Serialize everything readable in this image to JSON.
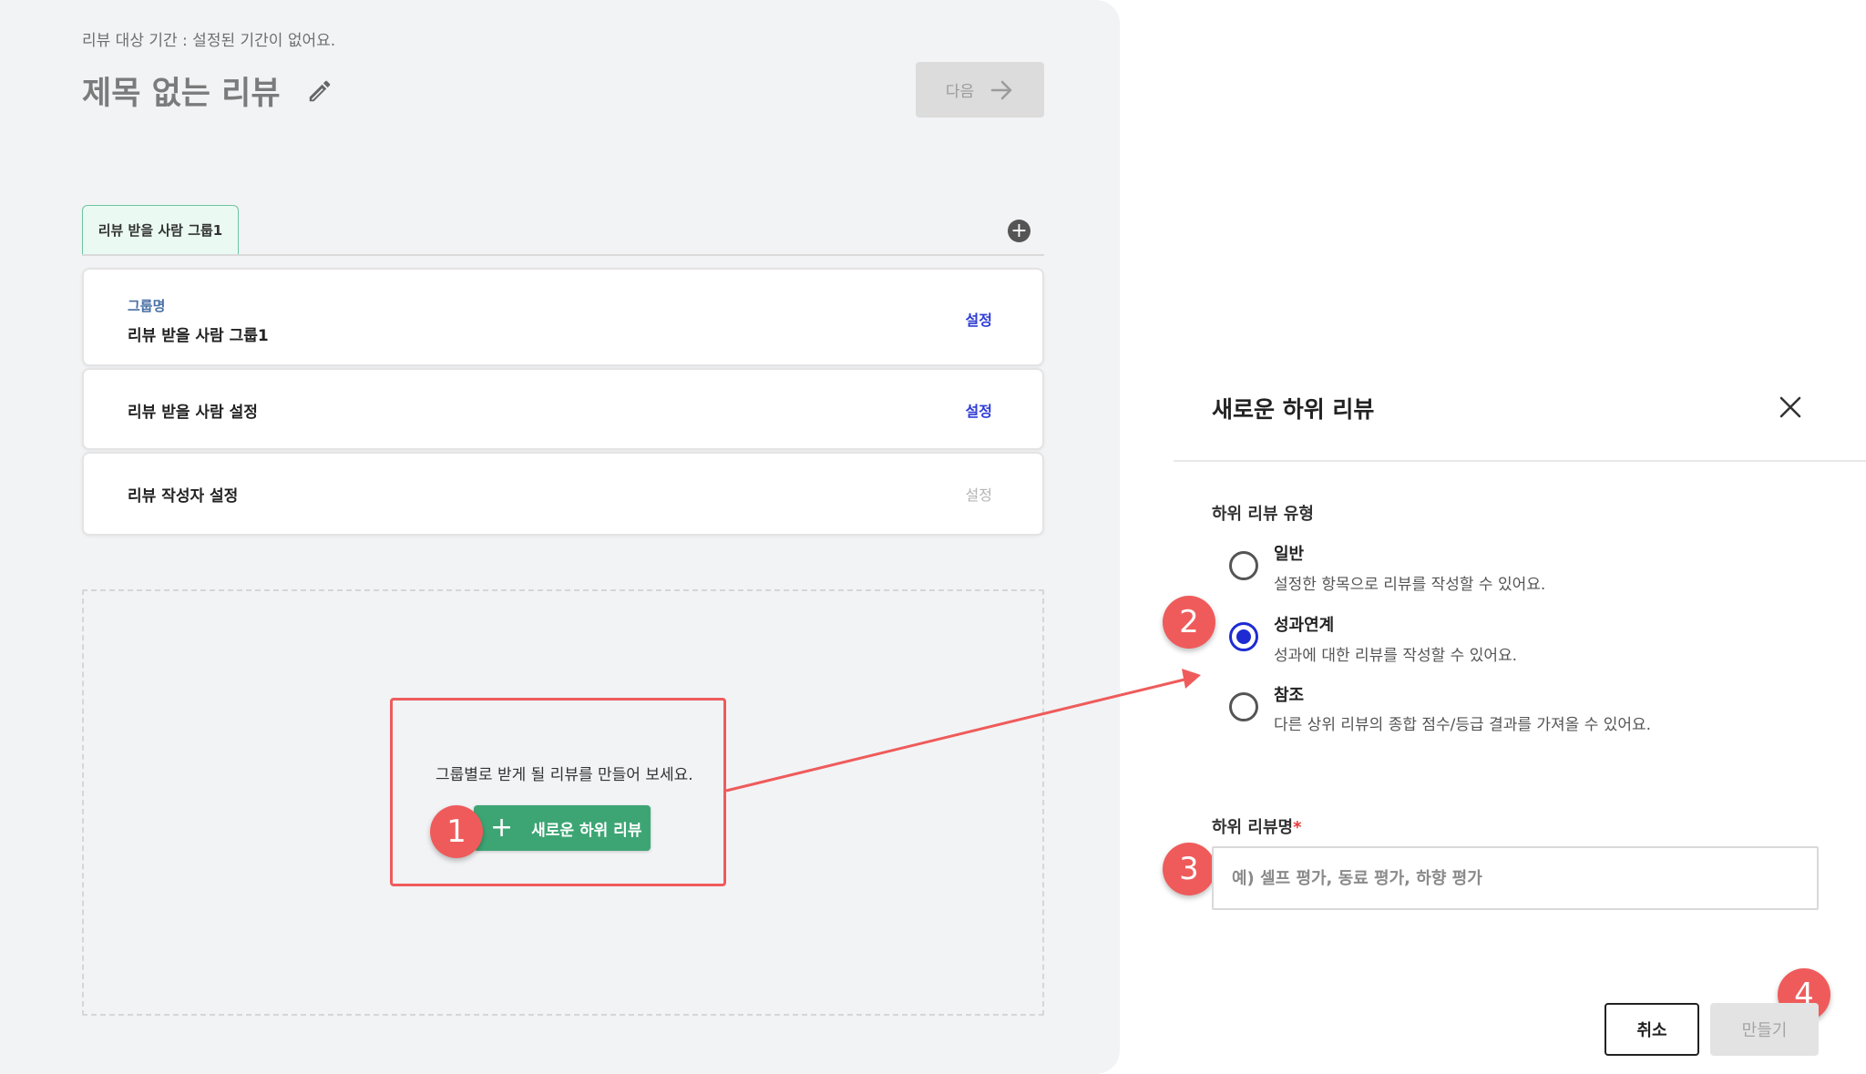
{
  "header": {
    "period_text": "리뷰 대상 기간 : 설정된 기간이 없어요.",
    "title": "제목 없는 리뷰",
    "next_label": "다음"
  },
  "group_tabs": [
    {
      "label": "리뷰 받을 사람 그룹1",
      "active": true
    }
  ],
  "group_card": {
    "group_name_label": "그룹명",
    "group_name_value": "리뷰 받을 사람 그룹1",
    "setting_label": "설정"
  },
  "setting_rows": [
    {
      "label": "리뷰 받을 사람 설정",
      "setting_label": "설정",
      "enabled": true
    },
    {
      "label": "리뷰 작성자 설정",
      "setting_label": "설정",
      "enabled": false
    }
  ],
  "empty_state": {
    "hint": "그룹별로 받게 될 리뷰를 만들어 보세요.",
    "button_label": "새로운 하위 리뷰"
  },
  "dialog": {
    "title": "새로운 하위 리뷰",
    "type_label": "하위 리뷰 유형",
    "options": [
      {
        "title": "일반",
        "desc": "설정한 항목으로 리뷰를 작성할 수 있어요.",
        "selected": false
      },
      {
        "title": "성과연계",
        "desc": "성과에 대한 리뷰를 작성할 수 있어요.",
        "selected": true
      },
      {
        "title": "참조",
        "desc": "다른 상위 리뷰의 종합 점수/등급 결과를 가져올 수 있어요.",
        "selected": false
      }
    ],
    "name_label": "하위 리뷰명",
    "required_mark": "*",
    "name_placeholder": "예) 셀프 평가, 동료 평가, 하향 평가",
    "name_value": "",
    "cancel_label": "취소",
    "create_label": "만들기"
  },
  "step_markers": [
    "1",
    "2",
    "3",
    "4"
  ],
  "colors": {
    "accent_green": "#3da574",
    "marker_red": "#ef5b5b",
    "link_blue": "#2d3bd6",
    "radio_blue": "#1e2bd2"
  }
}
